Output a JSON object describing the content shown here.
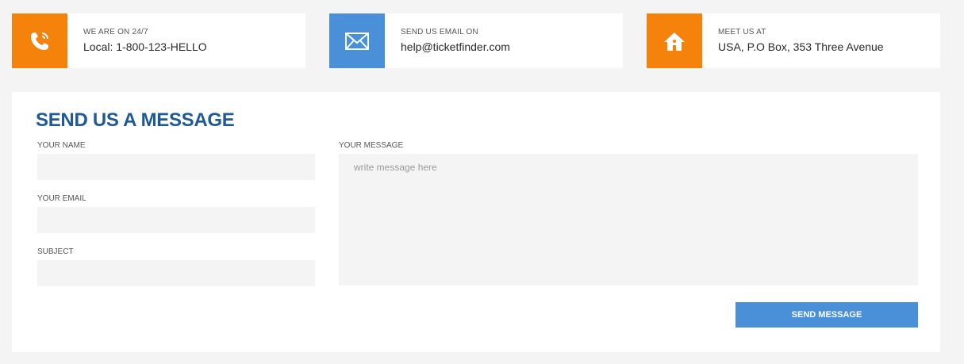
{
  "contact_cards": [
    {
      "label": "WE ARE ON 24/7",
      "value": "Local: 1-800-123-HELLO",
      "icon": "phone-icon",
      "color": "#f5820b"
    },
    {
      "label": "SEND US EMAIL ON",
      "value": "help@ticketfinder.com",
      "icon": "mail-icon",
      "color": "#4a90d9"
    },
    {
      "label": "MEET US AT",
      "value": "USA, P.O Box, 353 Three Avenue",
      "icon": "home-icon",
      "color": "#f5820b"
    }
  ],
  "form": {
    "title": "SEND US A MESSAGE",
    "name_label": "YOUR NAME",
    "email_label": "YOUR EMAIL",
    "subject_label": "SUBJECT",
    "message_label": "YOUR MESSAGE",
    "message_placeholder": "write message here",
    "submit_label": "SEND MESSAGE"
  },
  "colors": {
    "accent_orange": "#f5820b",
    "accent_blue": "#4a90d9",
    "title_blue": "#1f5a96",
    "page_bg": "#f4f4f4"
  }
}
